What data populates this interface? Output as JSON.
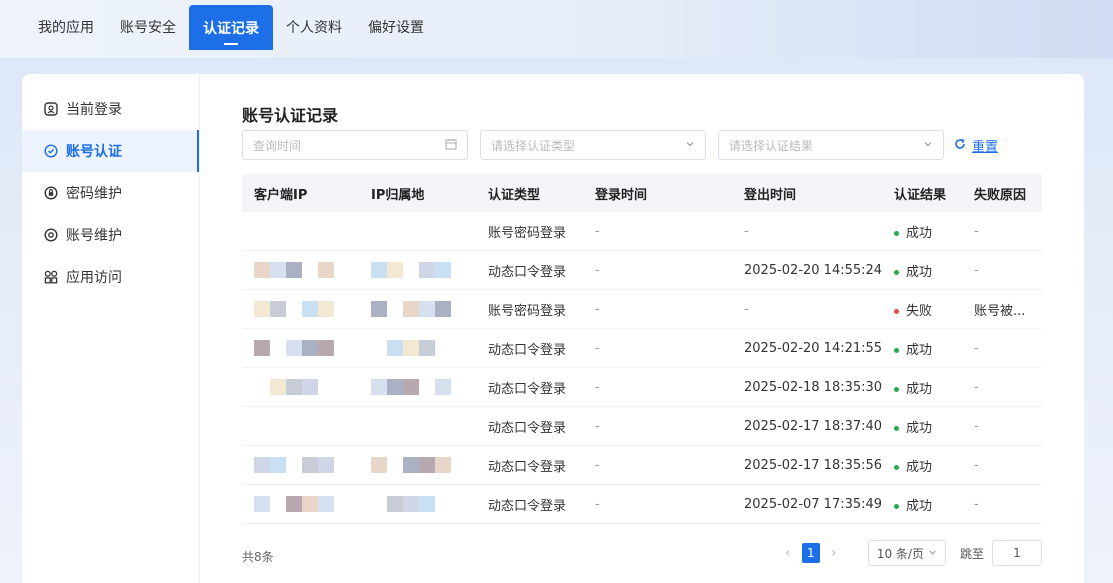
{
  "topnav": {
    "tabs": [
      {
        "label": "我的应用"
      },
      {
        "label": "账号安全"
      },
      {
        "label": "认证记录"
      },
      {
        "label": "个人资料"
      },
      {
        "label": "偏好设置"
      }
    ],
    "active_index": 2
  },
  "sidebar": {
    "items": [
      {
        "label": "当前登录",
        "icon": "user-circle-icon"
      },
      {
        "label": "账号认证",
        "icon": "shield-check-icon"
      },
      {
        "label": "密码维护",
        "icon": "lock-icon"
      },
      {
        "label": "账号维护",
        "icon": "gear-icon"
      },
      {
        "label": "应用访问",
        "icon": "grid-icon"
      }
    ],
    "active_index": 1
  },
  "main": {
    "title": "账号认证记录",
    "filters": {
      "time_placeholder": "查询时间",
      "type_placeholder": "请选择认证类型",
      "result_placeholder": "请选择认证结果",
      "reset_label": "重置"
    },
    "table": {
      "columns": [
        "客户端IP",
        "IP归属地",
        "认证类型",
        "登录时间",
        "登出时间",
        "认证结果",
        "失败原因"
      ],
      "rows": [
        {
          "type": "账号密码登录",
          "login": "-",
          "logout": "-",
          "result": "成功",
          "status": "success",
          "reason": "-"
        },
        {
          "type": "动态口令登录",
          "login": "-",
          "logout": "2025-02-20 14:55:24",
          "result": "成功",
          "status": "success",
          "reason": "-"
        },
        {
          "type": "账号密码登录",
          "login": "-",
          "logout": "-",
          "result": "失败",
          "status": "fail",
          "reason": "账号被..."
        },
        {
          "type": "动态口令登录",
          "login": "-",
          "logout": "2025-02-20 14:21:55",
          "result": "成功",
          "status": "success",
          "reason": "-"
        },
        {
          "type": "动态口令登录",
          "login": "-",
          "logout": "2025-02-18 18:35:30",
          "result": "成功",
          "status": "success",
          "reason": "-"
        },
        {
          "type": "动态口令登录",
          "login": "-",
          "logout": "2025-02-17 18:37:40",
          "result": "成功",
          "status": "success",
          "reason": "-"
        },
        {
          "type": "动态口令登录",
          "login": "-",
          "logout": "2025-02-17 18:35:56",
          "result": "成功",
          "status": "success",
          "reason": "-"
        },
        {
          "type": "动态口令登录",
          "login": "-",
          "logout": "2025-02-07 17:35:49",
          "result": "成功",
          "status": "success",
          "reason": "-"
        }
      ]
    },
    "footer": {
      "total": "共8条",
      "current_page": "1",
      "page_size": "10 条/页",
      "jump_label": "跳至",
      "jump_value": "1"
    }
  },
  "colors": {
    "accent": "#1d6fe8",
    "success": "#2aa84a",
    "fail": "#e5484d"
  }
}
